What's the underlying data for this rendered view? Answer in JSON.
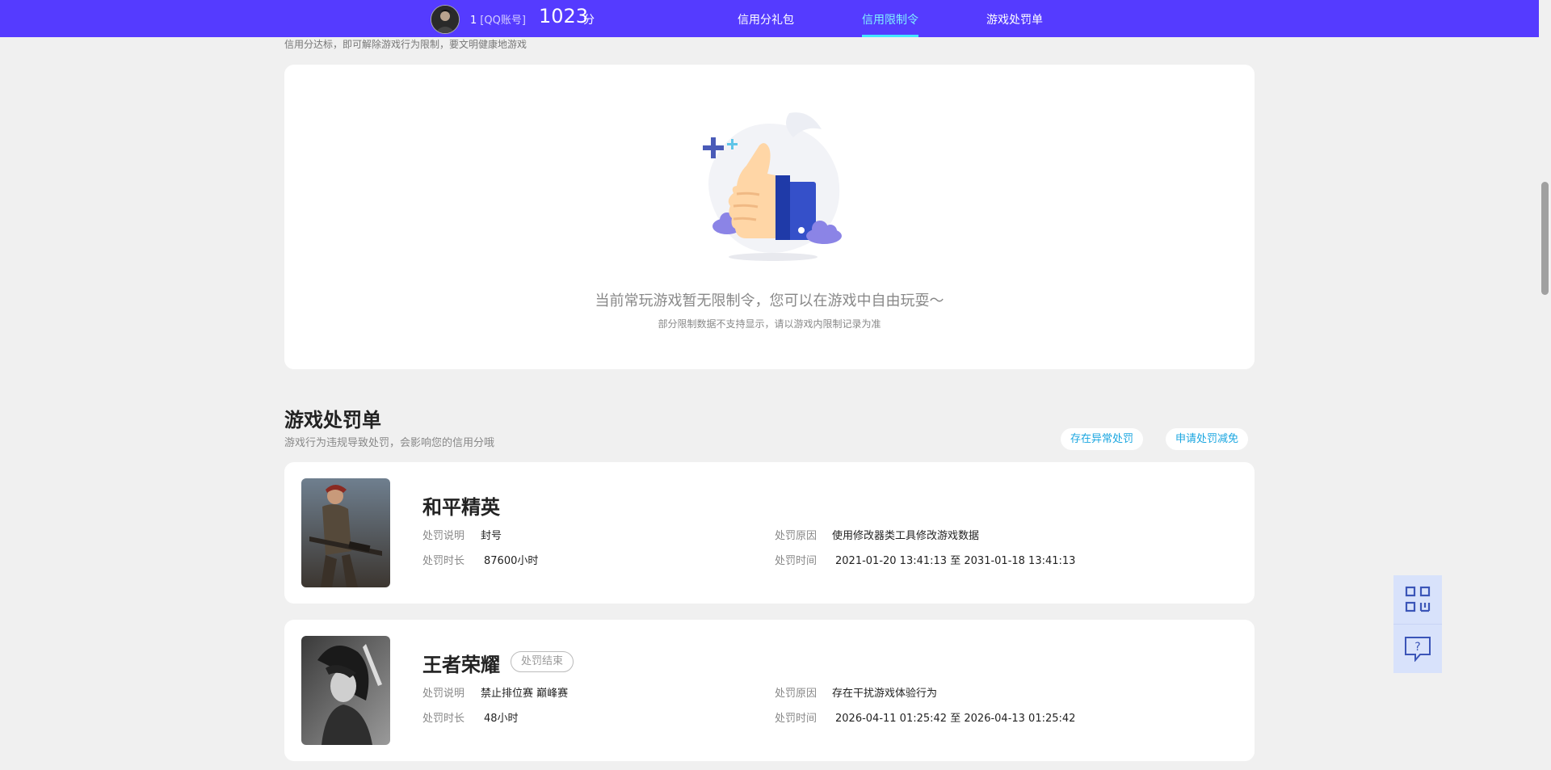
{
  "header": {
    "user_id": "1",
    "account_type": "[QQ账号]",
    "score": "1023",
    "score_unit": "分",
    "tabs": [
      {
        "label": "信用分礼包",
        "active": false
      },
      {
        "label": "信用限制令",
        "active": true
      },
      {
        "label": "游戏处罚单",
        "active": false
      }
    ]
  },
  "restriction": {
    "subtitle": "信用分达标，即可解除游戏行为限制，要文明健康地游戏",
    "empty_title": "当前常玩游戏暂无限制令，您可以在游戏中自由玩耍～",
    "empty_note": "部分限制数据不支持显示，请以游戏内限制记录为准"
  },
  "penalty": {
    "title": "游戏处罚单",
    "subtitle": "游戏行为违规导致处罚，会影响您的信用分哦",
    "btn_abnormal": "存在异常处罚",
    "btn_appeal": "申请处罚减免",
    "labels": {
      "desc": "处罚说明",
      "duration": "处罚时长",
      "reason": "处罚原因",
      "time": "处罚时间",
      "to": "至"
    },
    "items": [
      {
        "game": "和平精英",
        "badge": "",
        "desc": "封号",
        "duration": "87600小时",
        "reason": "使用修改器类工具修改游戏数据",
        "start": "2021-01-20 13:41:13",
        "end": "2031-01-18 13:41:13"
      },
      {
        "game": "王者荣耀",
        "badge": "处罚结束",
        "desc": "禁止排位赛 巅峰赛",
        "duration": "48小时",
        "reason": "存在干扰游戏体验行为",
        "start": "2026-04-11 01:25:42",
        "end": "2026-04-13 01:25:42"
      }
    ]
  },
  "colors": {
    "brand": "#553bff",
    "accent": "#43e6ff",
    "link": "#1aa6e0",
    "background": "#f0f0f0"
  },
  "icons": {
    "qr": "qr-code-icon",
    "help": "help-chat-icon"
  }
}
